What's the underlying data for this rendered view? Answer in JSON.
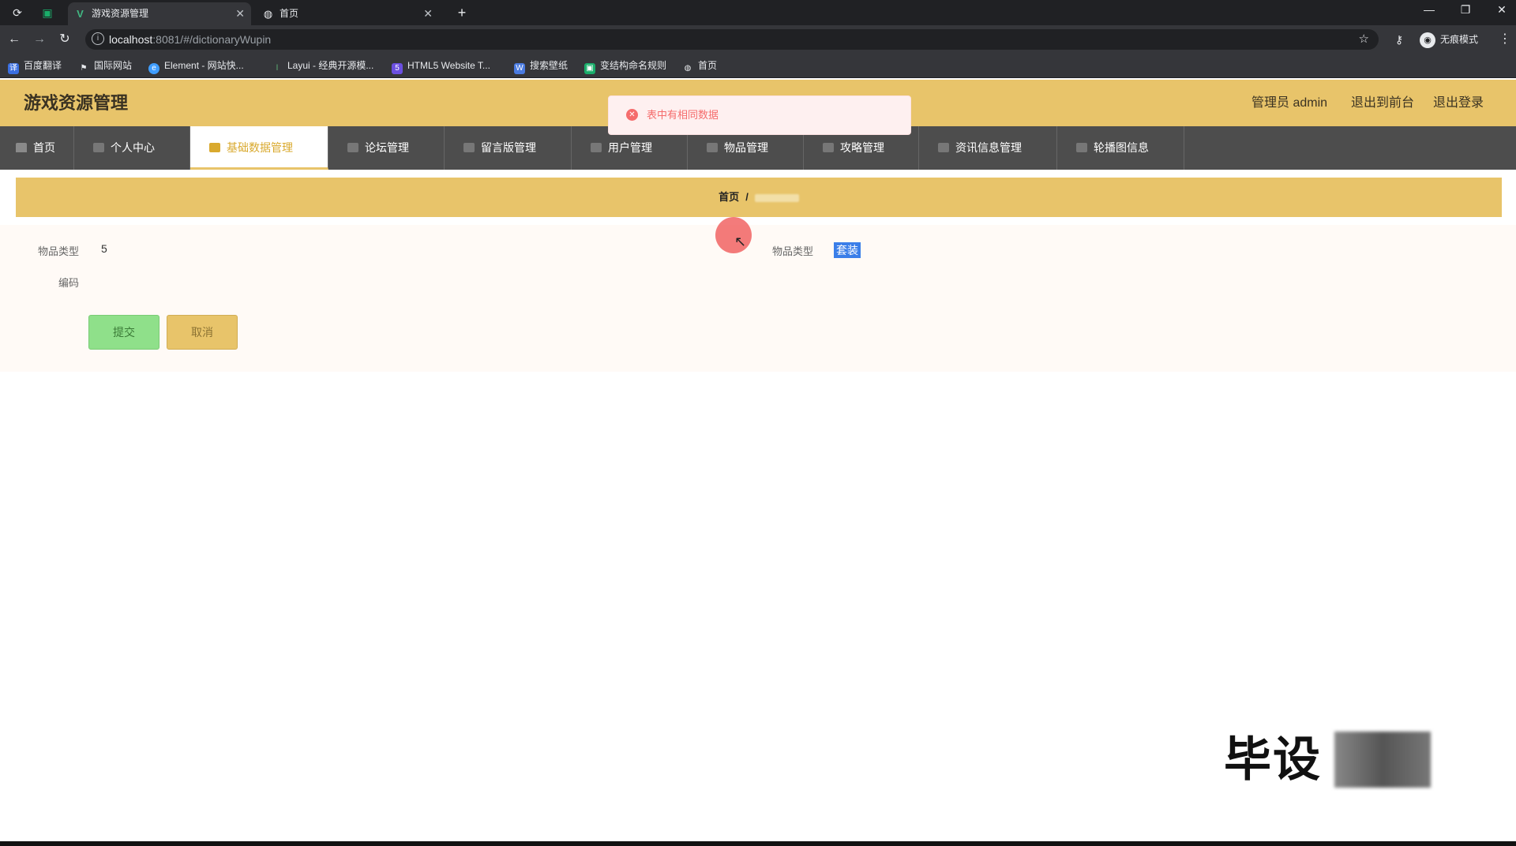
{
  "browser": {
    "tabs": [
      {
        "title": "游戏资源管理",
        "favicon": "vue-logo-icon",
        "active": true
      },
      {
        "title": "首页",
        "favicon": "globe-icon",
        "active": false
      }
    ],
    "url_host": "localhost",
    "url_path": ":8081/#/dictionaryWupin",
    "profile_label": "无痕模式",
    "bookmarks": [
      {
        "label": "百度翻译",
        "icon_color": "#3b6fe0"
      },
      {
        "label": "国际网站",
        "icon_color": "#e8eaed"
      },
      {
        "label": "Element - 网站快...",
        "icon_color": "#409eff"
      },
      {
        "label": "Layui - 经典开源模...",
        "icon_color": "#5fb878"
      },
      {
        "label": "HTML5 Website T...",
        "icon_color": "#6b4fe0"
      },
      {
        "label": "搜索壁纸",
        "icon_color": "#4a7be0"
      },
      {
        "label": "变结构命名规则",
        "icon_color": "#1aad6a"
      },
      {
        "label": "首页",
        "icon_color": "#e8eaed"
      }
    ]
  },
  "app": {
    "title": "游戏资源管理",
    "admin_label": "管理员 admin",
    "back_to_front": "退出到前台",
    "logout": "退出登录",
    "accent_color": "#e8c46a"
  },
  "nav": {
    "items": [
      {
        "label": "首页",
        "icon": "home-icon"
      },
      {
        "label": "个人中心",
        "icon": "user-icon"
      },
      {
        "label": "基础数据管理",
        "icon": "data-icon",
        "active": true
      },
      {
        "label": "论坛管理",
        "icon": "forum-icon"
      },
      {
        "label": "留言版管理",
        "icon": "message-icon"
      },
      {
        "label": "用户管理",
        "icon": "users-icon"
      },
      {
        "label": "物品管理",
        "icon": "goods-icon"
      },
      {
        "label": "攻略管理",
        "icon": "guide-icon"
      },
      {
        "label": "资讯信息管理",
        "icon": "news-icon"
      },
      {
        "label": "轮播图信息",
        "icon": "carousel-icon"
      }
    ]
  },
  "breadcrumb": {
    "home": "首页",
    "separator": "/",
    "current": ""
  },
  "toast": {
    "message": "表中有相同数据",
    "type": "error"
  },
  "form": {
    "fields": [
      {
        "label": "物品类型",
        "value": "5"
      },
      {
        "label": "物品类型",
        "value": "套装"
      },
      {
        "label": "编码",
        "value": ""
      }
    ],
    "submit_label": "提交",
    "cancel_label": "取消"
  },
  "watermark": {
    "text": "毕设"
  }
}
